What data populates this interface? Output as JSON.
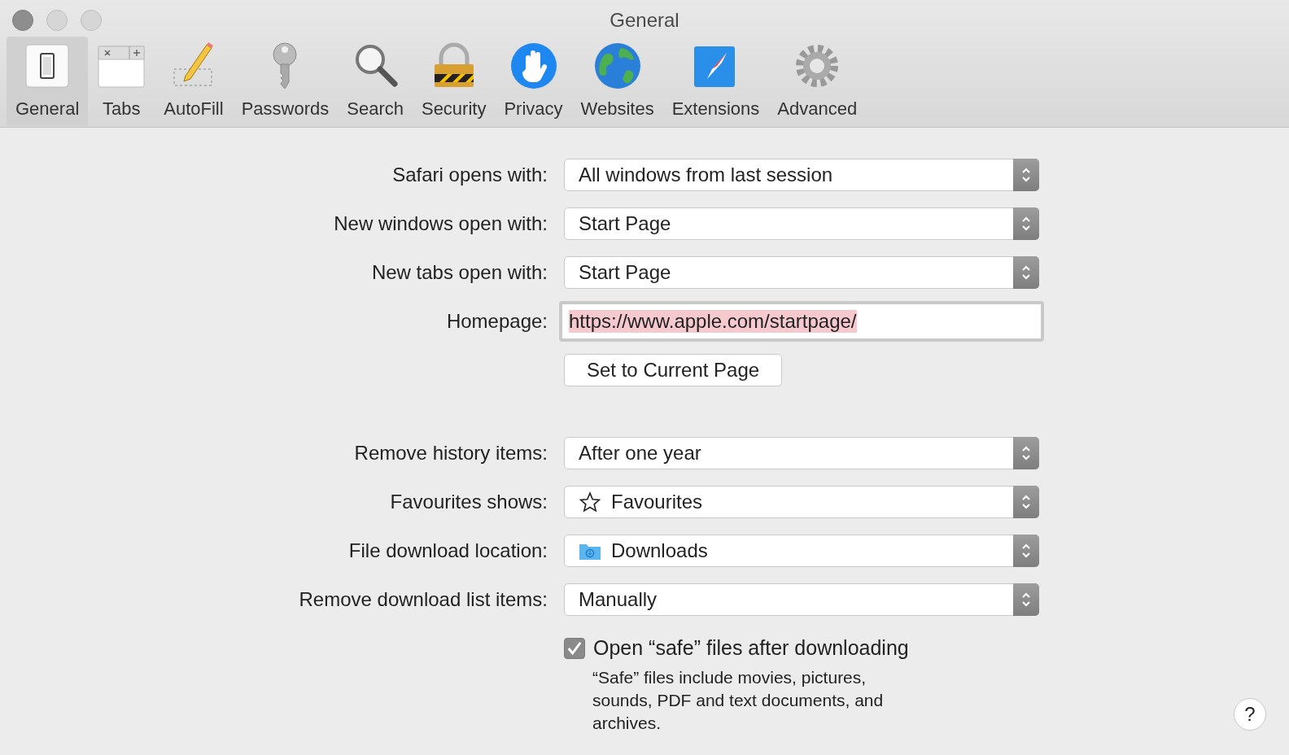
{
  "window": {
    "title": "General"
  },
  "toolbar": [
    {
      "label": "General",
      "selected": true
    },
    {
      "label": "Tabs",
      "selected": false
    },
    {
      "label": "AutoFill",
      "selected": false
    },
    {
      "label": "Passwords",
      "selected": false
    },
    {
      "label": "Search",
      "selected": false
    },
    {
      "label": "Security",
      "selected": false
    },
    {
      "label": "Privacy",
      "selected": false
    },
    {
      "label": "Websites",
      "selected": false
    },
    {
      "label": "Extensions",
      "selected": false
    },
    {
      "label": "Advanced",
      "selected": false
    }
  ],
  "page_settings": [
    {
      "kind": "popup",
      "label": "Safari opens with:",
      "value": "All windows from last session"
    },
    {
      "kind": "popup",
      "label": "New windows open with:",
      "value": "Start Page"
    },
    {
      "kind": "popup",
      "label": "New tabs open with:",
      "value": "Start Page"
    },
    {
      "kind": "field",
      "label": "Homepage:",
      "value": "https://www.apple.com/startpage/",
      "text_selected": true
    },
    {
      "kind": "button",
      "value": "Set to Current Page"
    }
  ],
  "history_settings": [
    {
      "kind": "popup",
      "label": "Remove history items:",
      "value": "After one year"
    },
    {
      "kind": "star",
      "label": "Favourites shows:",
      "value": "Favourites"
    },
    {
      "kind": "folder",
      "label": "File download location:",
      "value": "Downloads"
    },
    {
      "kind": "popup",
      "label": "Remove download list items:",
      "value": "Manually"
    }
  ],
  "safe_files": {
    "label": "Open “safe” files after downloading",
    "checked": true,
    "note": "“Safe” files include movies, pictures, sounds, PDF and text documents, and archives."
  },
  "help_button": "?"
}
